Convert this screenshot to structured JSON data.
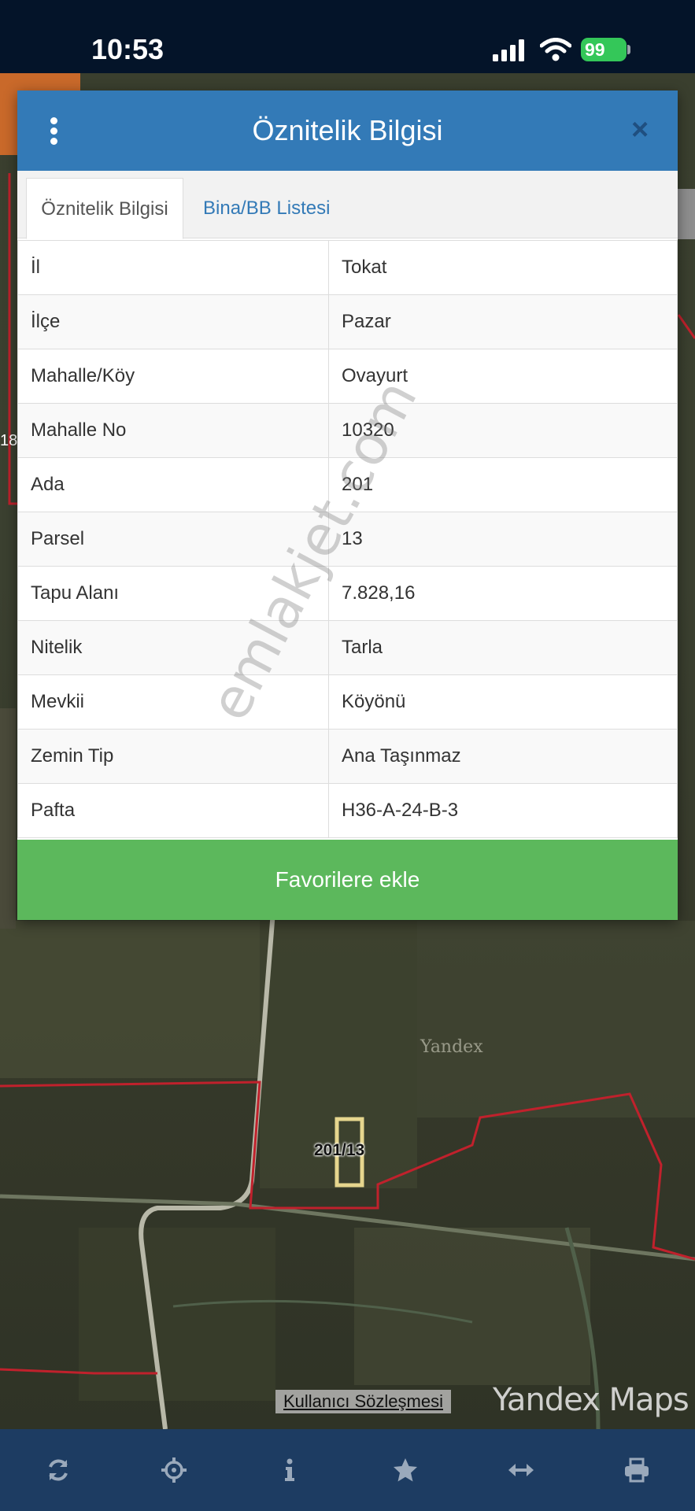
{
  "status_bar": {
    "time": "10:53",
    "battery": "99"
  },
  "modal": {
    "title": "Öznitelik Bilgisi",
    "close_label": "×",
    "tabs": [
      {
        "label": "Öznitelik Bilgisi",
        "active": true
      },
      {
        "label": "Bina/BB Listesi",
        "active": false
      }
    ],
    "rows": [
      {
        "key": "İl",
        "value": "Tokat"
      },
      {
        "key": "İlçe",
        "value": "Pazar"
      },
      {
        "key": "Mahalle/Köy",
        "value": "Ovayurt"
      },
      {
        "key": "Mahalle No",
        "value": "10320"
      },
      {
        "key": "Ada",
        "value": "201"
      },
      {
        "key": "Parsel",
        "value": "13"
      },
      {
        "key": "Tapu Alanı",
        "value": "7.828,16"
      },
      {
        "key": "Nitelik",
        "value": "Tarla"
      },
      {
        "key": "Mevkii",
        "value": "Köyönü"
      },
      {
        "key": "Zemin Tip",
        "value": "Ana Taşınmaz"
      },
      {
        "key": "Pafta",
        "value": "H36-A-24-B-3"
      }
    ],
    "favorite_button": "Favorilere ekle"
  },
  "map": {
    "parcel_label": "201/13",
    "yandex_label": "Yandex",
    "side_label": "18",
    "terms_link": "Kullanıcı Sözleşmesi",
    "logo": "Yandex Maps"
  },
  "watermark": "emlakjet.com",
  "toolbar": {
    "icons": [
      "refresh-icon",
      "locate-icon",
      "info-icon",
      "star-icon",
      "measure-icon",
      "print-icon"
    ]
  },
  "colors": {
    "header_blue": "#337ab7",
    "button_green": "#5cb85c",
    "toolbar_bg": "#1d3c62",
    "parcel_red": "#c0212c"
  }
}
